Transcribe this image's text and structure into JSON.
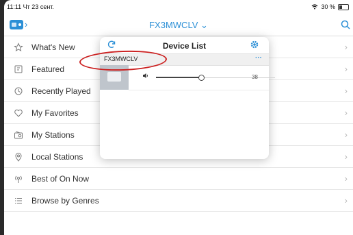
{
  "status": {
    "time_day": "11:11  Чт 23 сент.",
    "battery": "30 %"
  },
  "nav": {
    "title": "FX3MWCLV ⌄"
  },
  "menu": {
    "items": [
      {
        "label": "What's New",
        "icon": "star-icon"
      },
      {
        "label": "Featured",
        "icon": "featured-icon"
      },
      {
        "label": "Recently Played",
        "icon": "clock-icon"
      },
      {
        "label": "My Favorites",
        "icon": "heart-icon"
      },
      {
        "label": "My Stations",
        "icon": "radio-icon"
      },
      {
        "label": "Local Stations",
        "icon": "location-pin-icon"
      },
      {
        "label": "Best of On Now",
        "icon": "broadcast-icon"
      },
      {
        "label": "Browse by Genres",
        "icon": "list-icon"
      }
    ]
  },
  "popover": {
    "title": "Device List",
    "device": {
      "name": "FX3MWCLV",
      "more": "···"
    },
    "volume": {
      "value": "38",
      "level": 0.38
    }
  },
  "colors": {
    "accent": "#2b8fd6",
    "annotation": "#cc2222"
  }
}
